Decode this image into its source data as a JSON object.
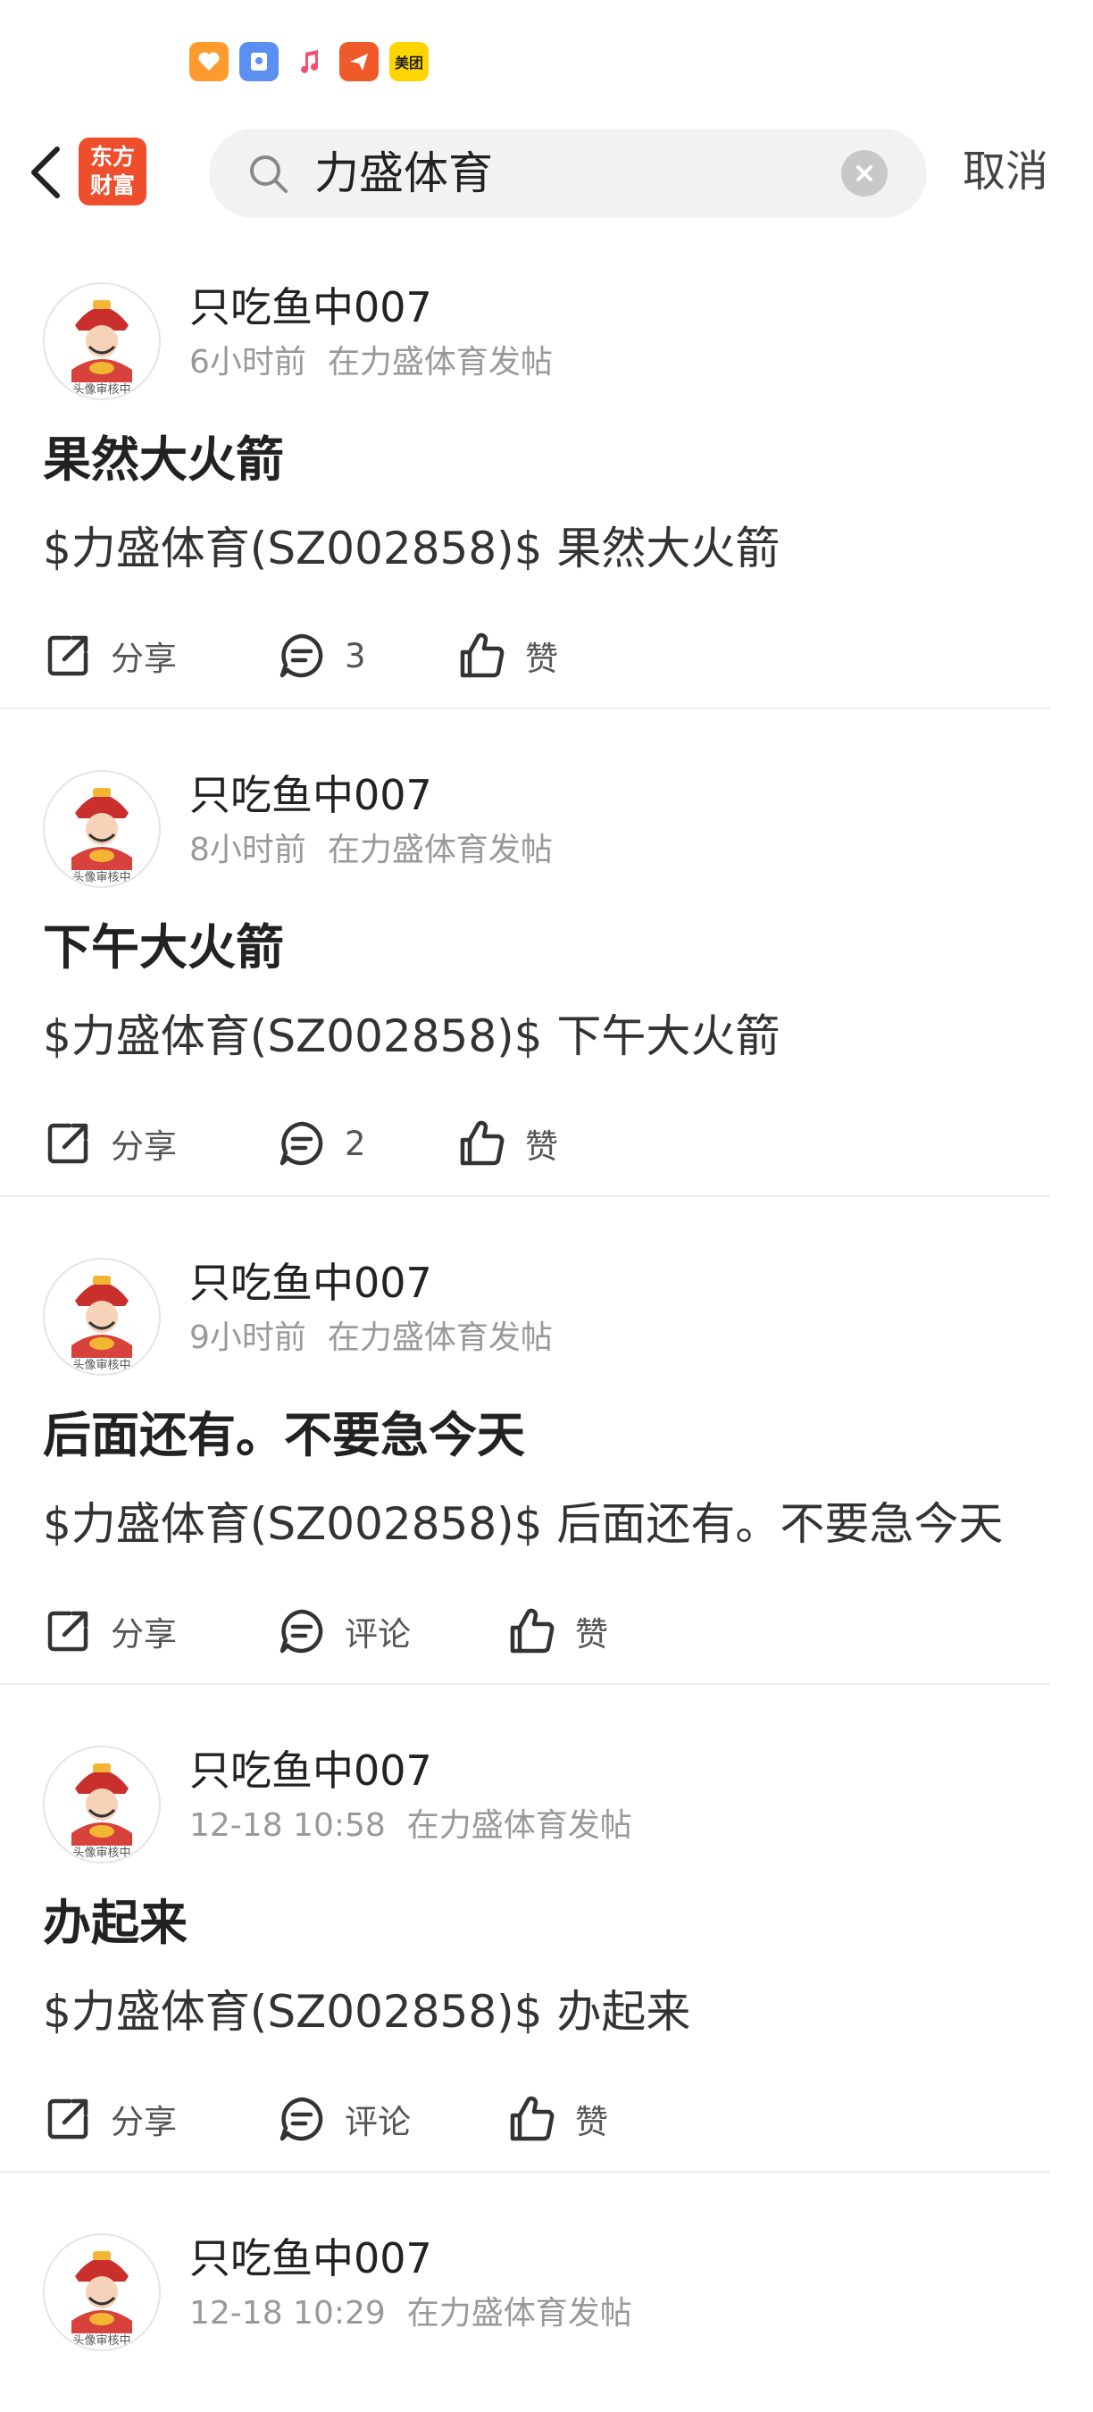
{
  "status_bar": {
    "icons": [
      "health-app-icon",
      "wallet-app-icon",
      "music-app-icon",
      "message-app-icon",
      "meituan-app-icon"
    ],
    "meituan_label": "美团"
  },
  "header": {
    "brand_line1": "东方",
    "brand_line2": "财富",
    "search_value": "力盛体育",
    "cancel_label": "取消"
  },
  "actions": {
    "share_label": "分享",
    "comment_label": "评论",
    "like_label": "赞"
  },
  "avatar": {
    "caption": "头像审核中"
  },
  "posts": [
    {
      "author": "只吃鱼中007",
      "time": "6小时前",
      "location": "在力盛体育发帖",
      "title": "果然大火箭",
      "body": "$力盛体育(SZ002858)$ 果然大火箭",
      "comments": "3"
    },
    {
      "author": "只吃鱼中007",
      "time": "8小时前",
      "location": "在力盛体育发帖",
      "title": "下午大火箭",
      "body": "$力盛体育(SZ002858)$ 下午大火箭",
      "comments": "2"
    },
    {
      "author": "只吃鱼中007",
      "time": "9小时前",
      "location": "在力盛体育发帖",
      "title": "后面还有。不要急今天",
      "body": "$力盛体育(SZ002858)$ 后面还有。不要急今天",
      "comments": "评论"
    },
    {
      "author": "只吃鱼中007",
      "time": "12-18 10:58",
      "location": "在力盛体育发帖",
      "title": "办起来",
      "body": "$力盛体育(SZ002858)$ 办起来",
      "comments": "评论"
    },
    {
      "author": "只吃鱼中007",
      "time": "12-18 10:29",
      "location": "在力盛体育发帖"
    }
  ]
}
